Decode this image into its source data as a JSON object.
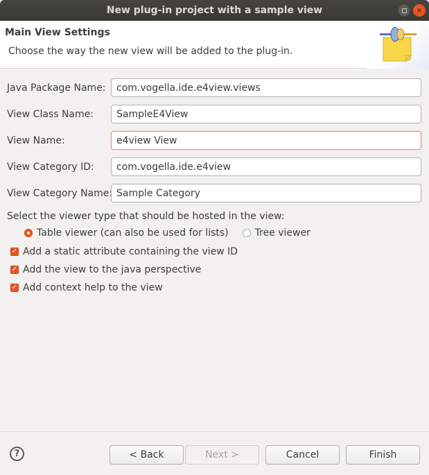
{
  "window": {
    "title": "New plug-in project with a sample view",
    "maximize_icon": "maximize-icon",
    "close_icon": "close-icon",
    "close_glyph": "×"
  },
  "header": {
    "title": "Main View Settings",
    "description": "Choose the way the new view will be added to the plug-in.",
    "icon": "plugin-view-wizard-icon"
  },
  "fields": [
    {
      "label": "Java Package Name:",
      "value": "com.vogella.ide.e4view.views",
      "focused": false
    },
    {
      "label": "View Class Name:",
      "value": "SampleE4View",
      "focused": false
    },
    {
      "label": "View Name:",
      "value": "e4view View",
      "focused": true
    },
    {
      "label": "View Category ID:",
      "value": "com.vogella.ide.e4view",
      "focused": false
    },
    {
      "label": "View Category Name:",
      "value": "Sample Category",
      "focused": false
    }
  ],
  "viewer": {
    "label": "Select the viewer type that should be hosted in the view:",
    "options": [
      {
        "label": "Table viewer (can also be used for lists)",
        "selected": true
      },
      {
        "label": "Tree viewer",
        "selected": false
      }
    ]
  },
  "checkboxes": [
    {
      "label": "Add a static attribute containing the view ID",
      "checked": true
    },
    {
      "label": "Add the view to the java perspective",
      "checked": true
    },
    {
      "label": "Add context help to the view",
      "checked": true
    }
  ],
  "footer": {
    "help_glyph": "?",
    "buttons": {
      "back": "< Back",
      "next": "Next >",
      "cancel": "Cancel",
      "finish": "Finish"
    },
    "next_disabled": true
  },
  "colors": {
    "accent": "#e95420",
    "titlebar": "#3c3b37"
  },
  "check_glyph": "✓"
}
